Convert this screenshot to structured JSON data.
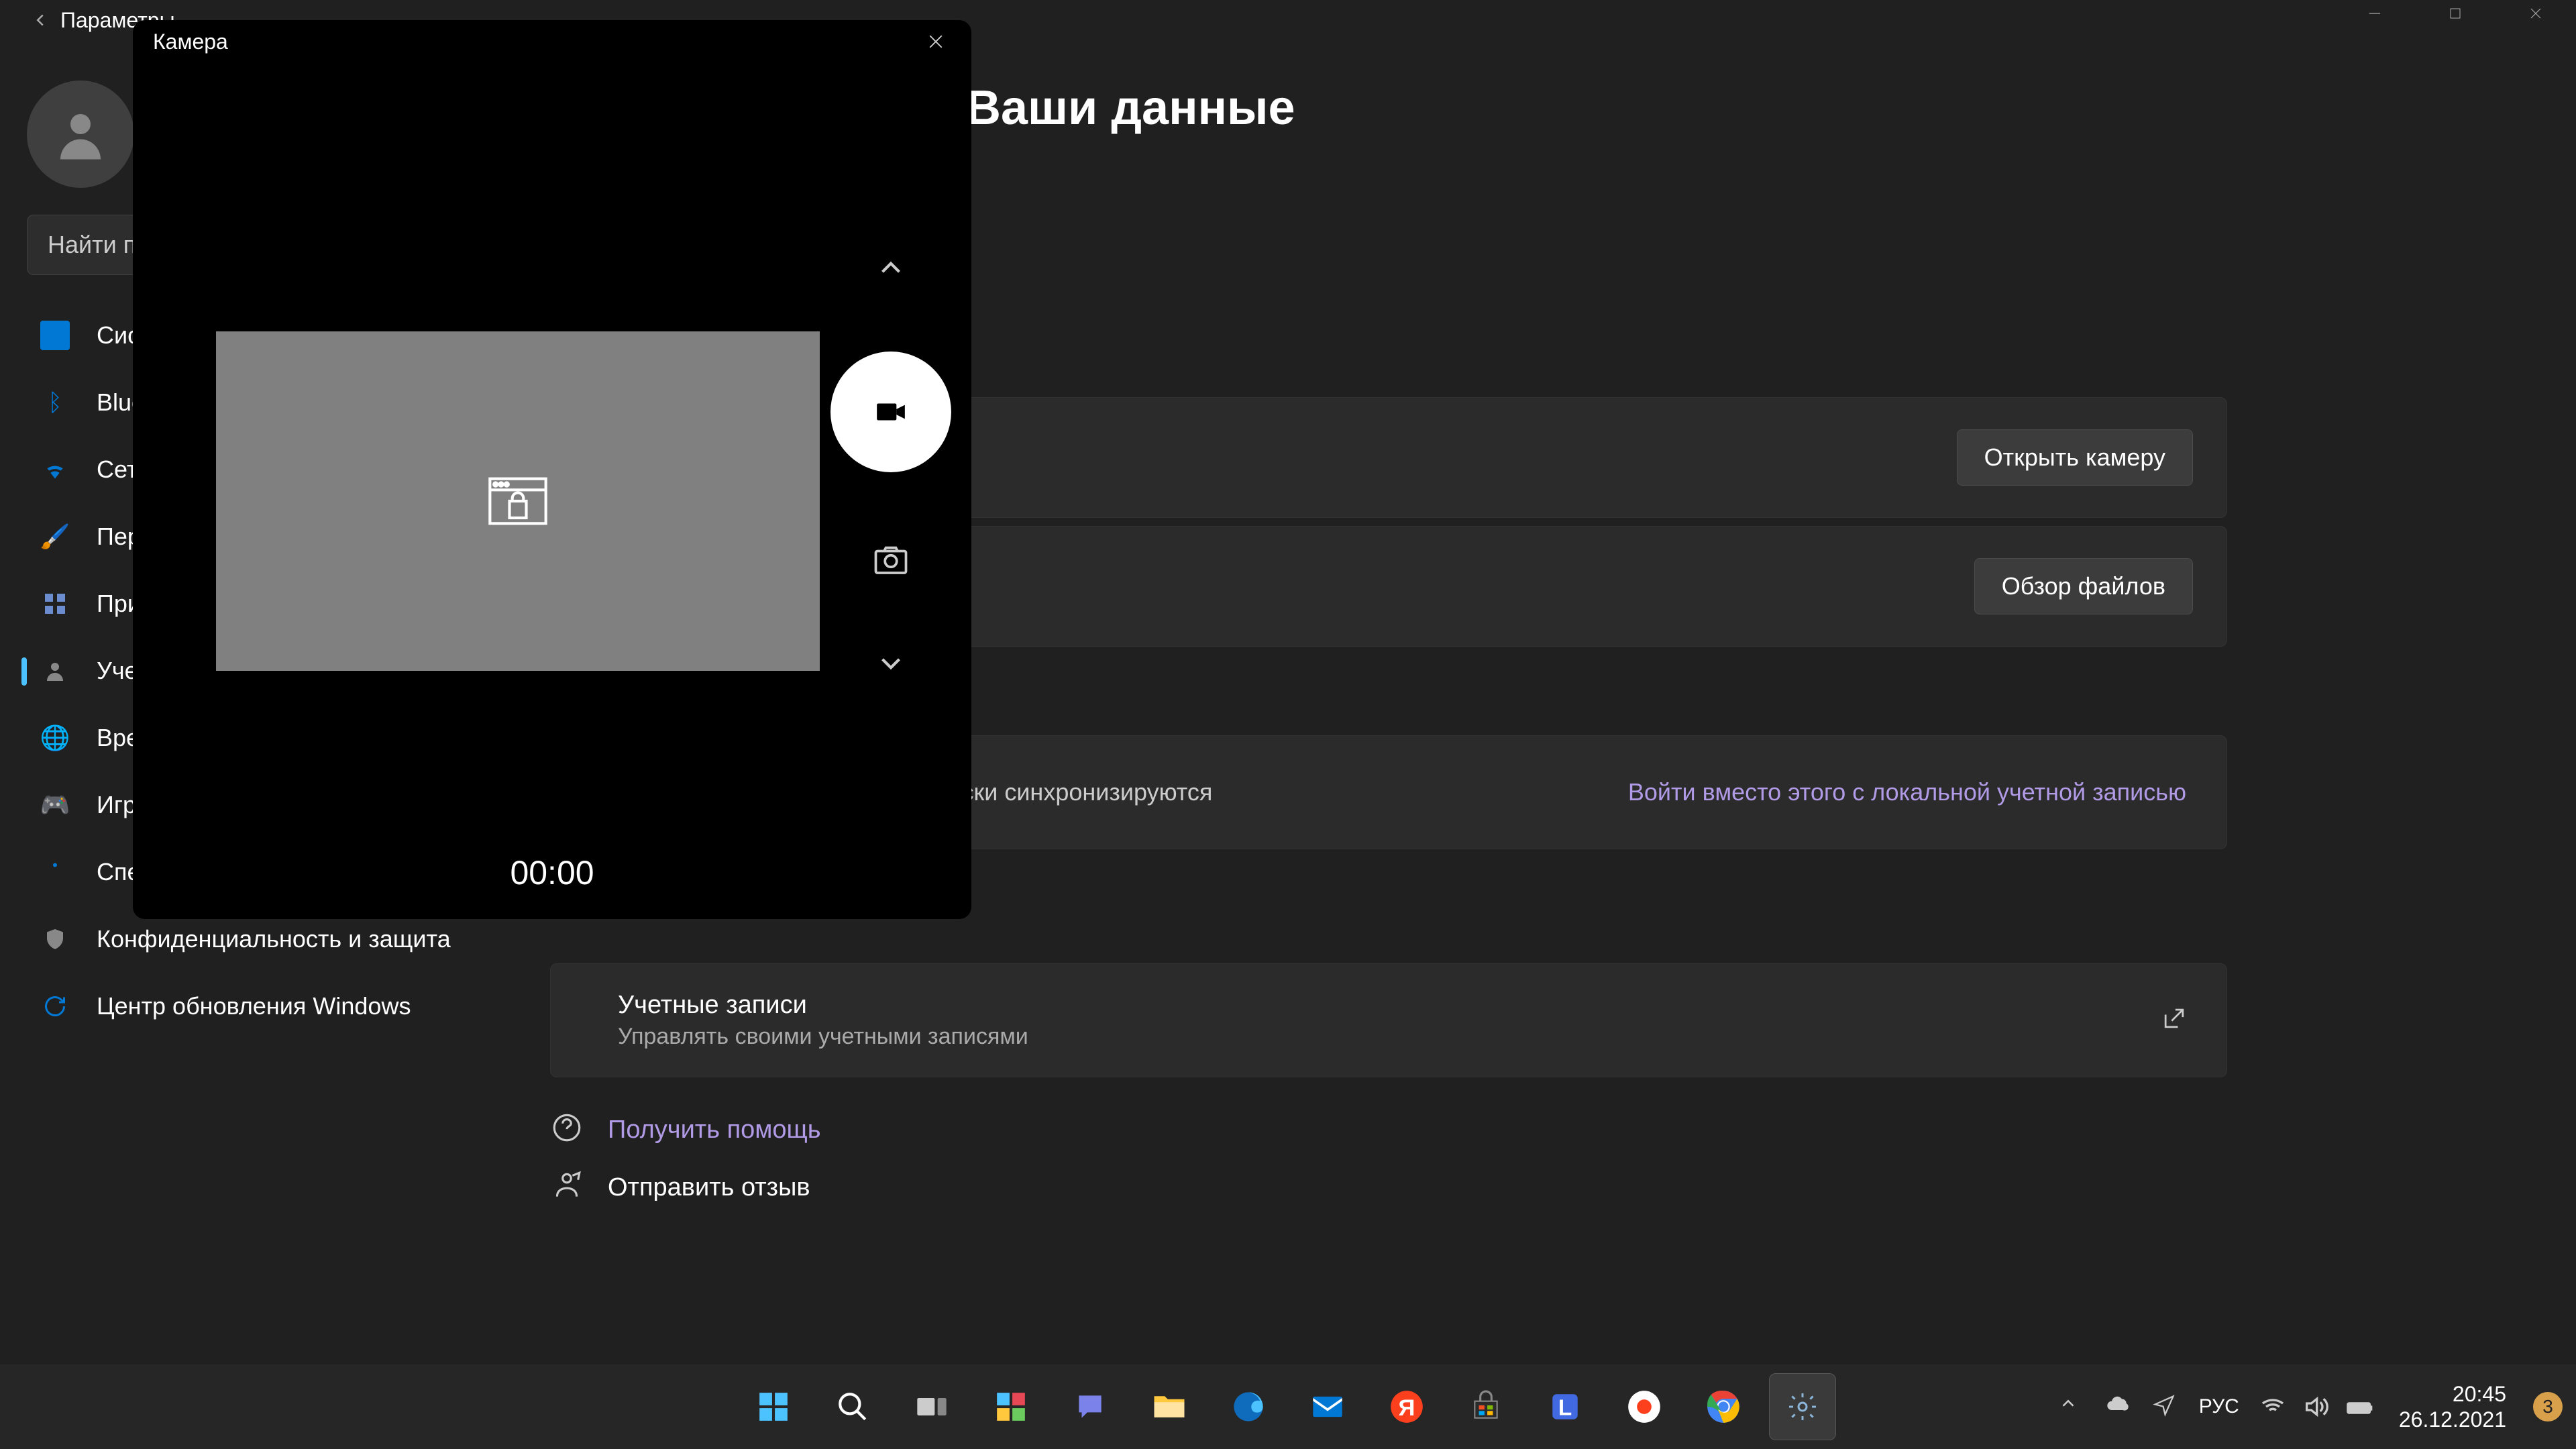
{
  "settings": {
    "titlebar_title": "Параметры",
    "search_placeholder": "Найти параметр",
    "sidebar": {
      "items": [
        {
          "label": "Система",
          "color": "#0078d4"
        },
        {
          "label": "Bluetooth и устройства",
          "color": "#0078d4"
        },
        {
          "label": "Сеть и Интернет",
          "color": "#0078d4"
        },
        {
          "label": "Персонализация",
          "color": "#ff8c00"
        },
        {
          "label": "Приложения",
          "color": "#6b69d6"
        },
        {
          "label": "Учетные записи",
          "color": "#7a7574"
        },
        {
          "label": "Время и язык",
          "color": "#0078d4"
        },
        {
          "label": "Игры",
          "color": "#7a7574"
        },
        {
          "label": "Специальные возможности",
          "color": "#0078d4"
        },
        {
          "label": "Конфиденциальность и защита",
          "color": "#888"
        },
        {
          "label": "Центр обновления Windows",
          "color": "#0078d4"
        }
      ]
    },
    "page_title": "Ваши данные",
    "open_camera_btn": "Открыть камеру",
    "browse_files_btn": "Обзор файлов",
    "sync_text": "Параметры и файлы автоматически синхронизируются",
    "local_login_link": "Войти вместо этого с локальной учетной записью",
    "accounts_title": "Учетные записи",
    "accounts_sub": "Управлять своими учетными записями",
    "help_link": "Получить помощь",
    "feedback_link": "Отправить отзыв"
  },
  "camera": {
    "title": "Камера",
    "timer": "00:00"
  },
  "taskbar": {
    "apps": [
      "start",
      "search",
      "taskview",
      "widgets",
      "chat",
      "explorer",
      "edge",
      "mail",
      "yandex",
      "store",
      "lingualeo",
      "yandex-browser",
      "chrome",
      "settings"
    ]
  },
  "tray": {
    "lang": "РУС",
    "time": "20:45",
    "date": "26.12.2021",
    "notif_count": "3"
  }
}
